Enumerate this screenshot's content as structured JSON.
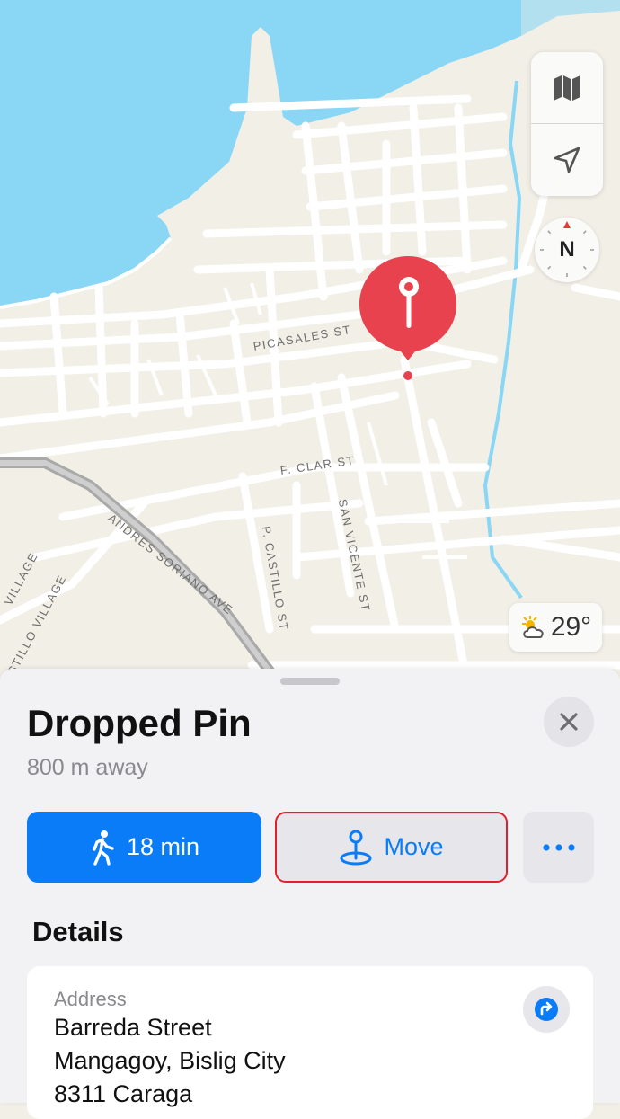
{
  "map": {
    "streets": [
      "PICASALES ST",
      "F. CLAR ST",
      "ANDRES SORIANO AVE",
      "SAN VICENTE ST",
      "P. CASTILLO ST",
      "VILLAGE",
      "STILLO VILLAGE"
    ],
    "compass_label": "N",
    "weather_temp": "29°",
    "colors": {
      "land": "#f1efe6",
      "water": "#8ad6f5",
      "road": "#ffffff",
      "highway": "#a9a9a9",
      "pin": "#e8424f"
    },
    "icons": [
      "map-mode-icon",
      "location-arrow-icon",
      "compass-icon",
      "partly-cloudy-icon",
      "dropped-pin-icon"
    ]
  },
  "sheet": {
    "title": "Dropped Pin",
    "subtitle": "800 m away",
    "walk_label": "18 min",
    "move_label": "Move",
    "details_heading": "Details",
    "address_label": "Address",
    "address_lines": [
      "Barreda Street",
      "Mangagoy, Bislig City",
      "8311 Caraga"
    ],
    "accent": "#0a7cf8"
  }
}
